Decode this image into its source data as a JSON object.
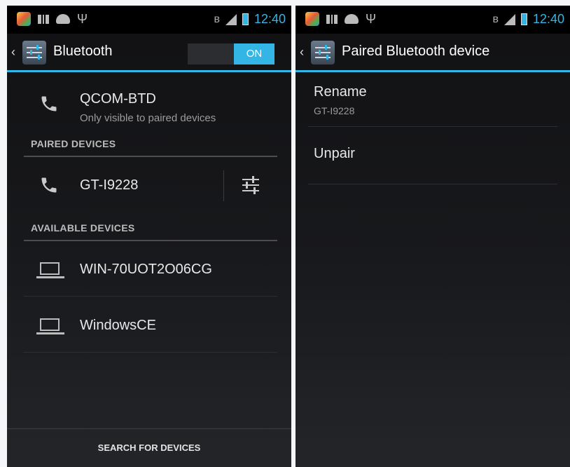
{
  "status_bar": {
    "time": "12:40"
  },
  "left_screen": {
    "title": "Bluetooth",
    "toggle_label": "ON",
    "this_device": {
      "name": "QCOM-BTD",
      "subtitle": "Only visible to paired devices"
    },
    "paired_header": "PAIRED DEVICES",
    "paired_devices": [
      {
        "name": "GT-I9228",
        "icon": "phone-icon"
      }
    ],
    "available_header": "AVAILABLE DEVICES",
    "available_devices": [
      {
        "name": "WIN-70UOT2O06CG",
        "icon": "laptop-icon"
      },
      {
        "name": "WindowsCE",
        "icon": "laptop-icon"
      }
    ],
    "search_button": "SEARCH FOR DEVICES"
  },
  "right_screen": {
    "title": "Paired Bluetooth device",
    "rename_label": "Rename",
    "rename_value": "GT-I9228",
    "unpair_label": "Unpair"
  },
  "colors": {
    "accent": "#33b5e5",
    "background": "#151618"
  }
}
